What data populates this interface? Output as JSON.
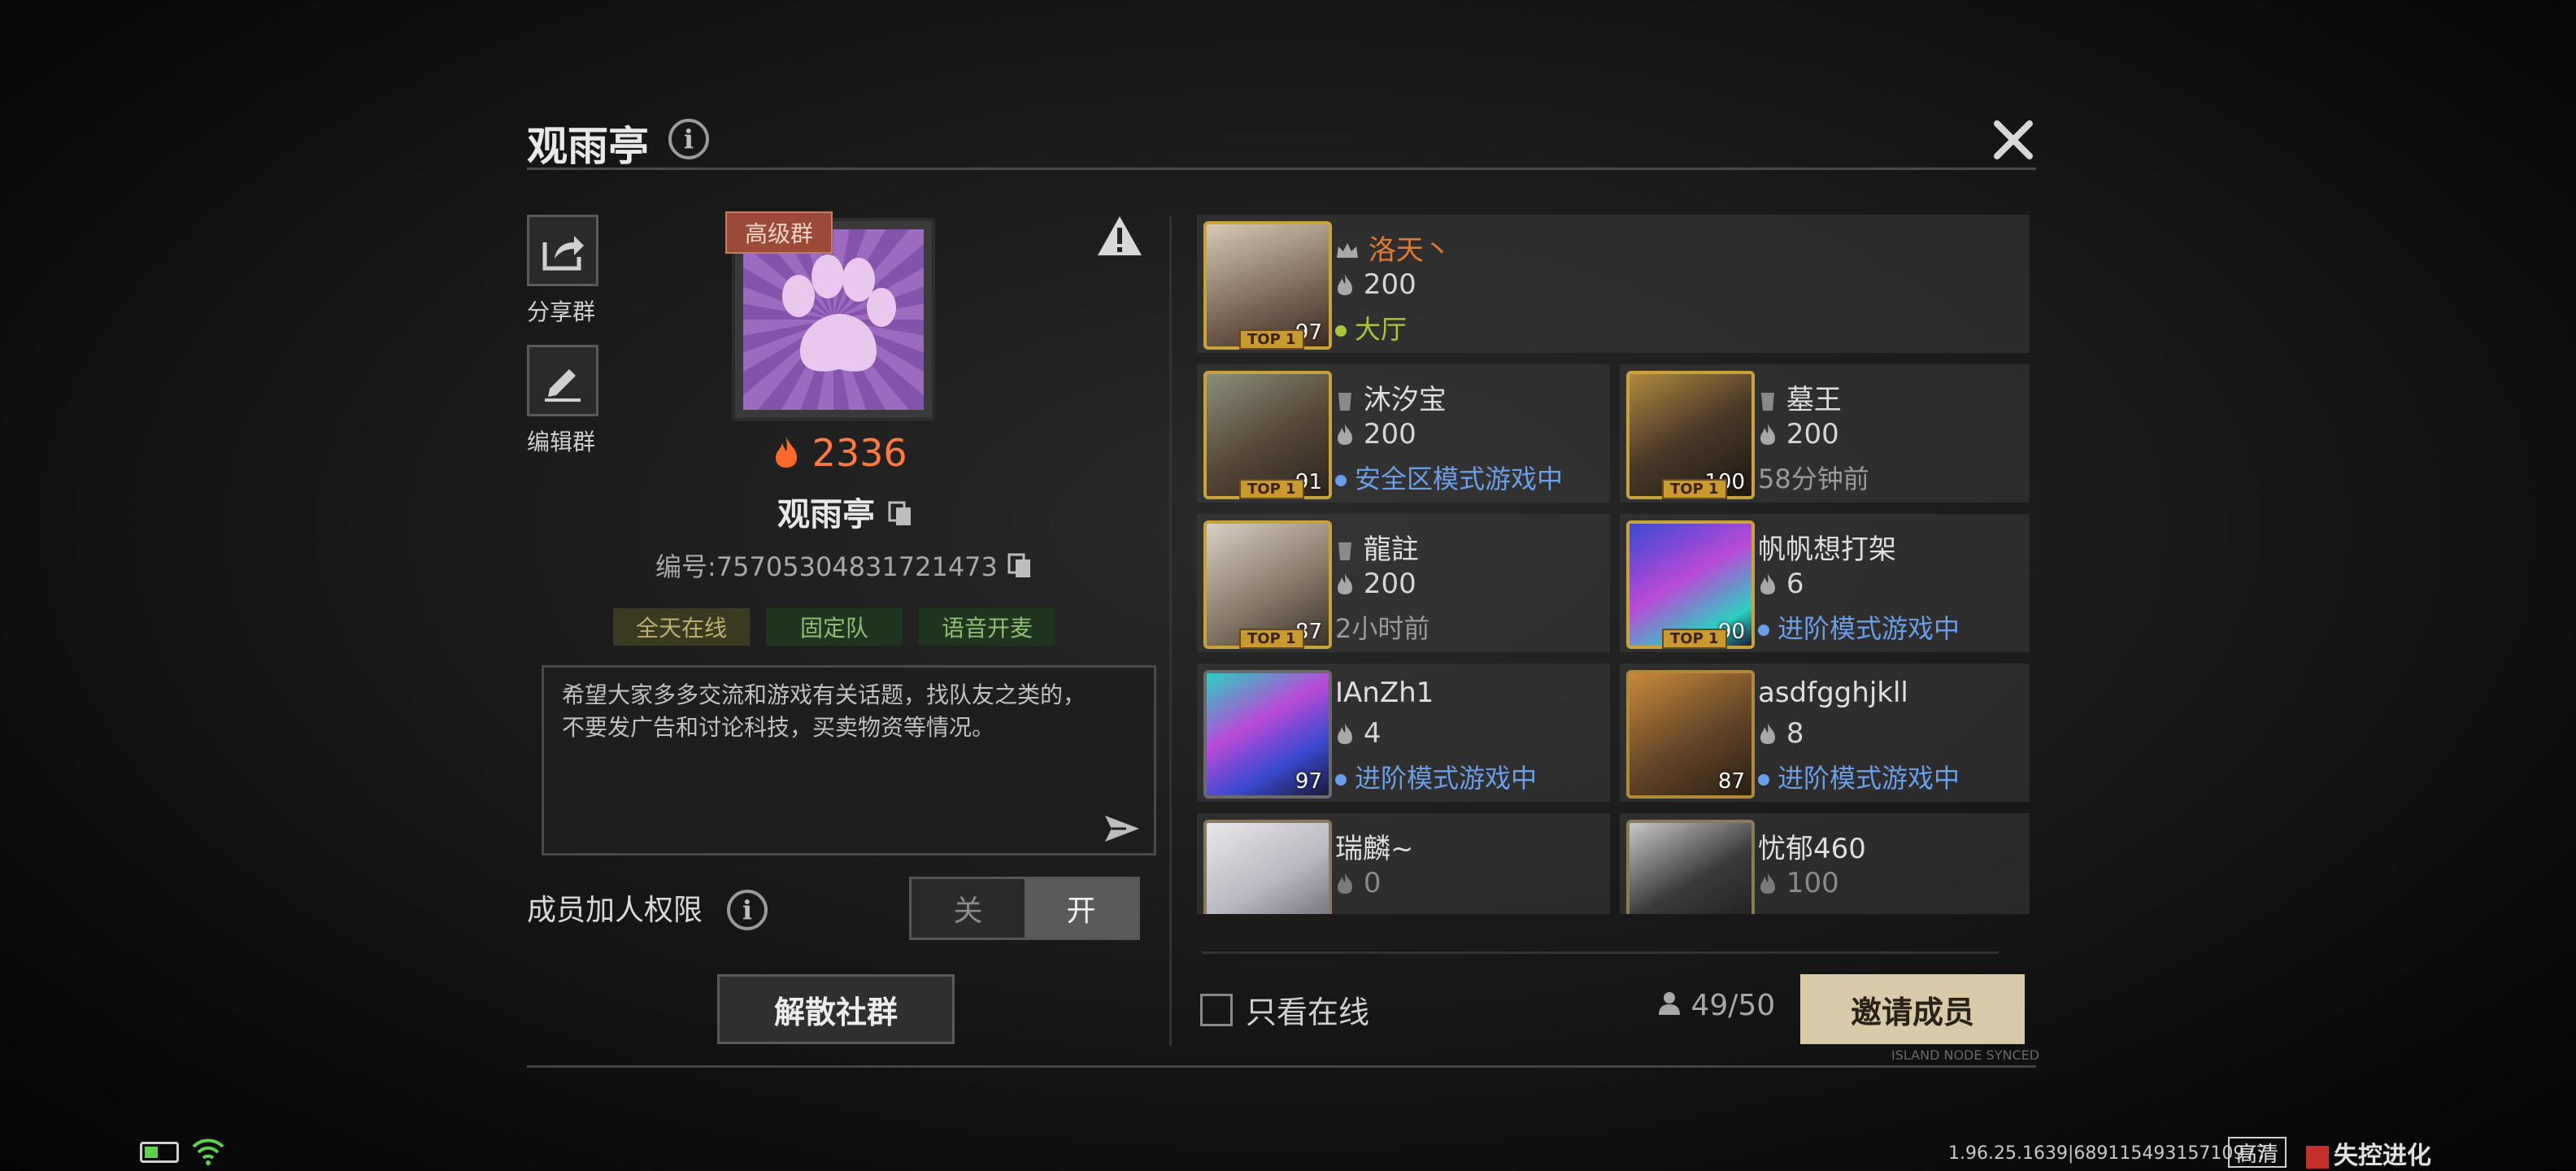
{
  "header": {
    "title": "观雨亭",
    "info_glyph": "i"
  },
  "sidebar": {
    "share_label": "分享群",
    "edit_label": "编辑群"
  },
  "group": {
    "tag": "高级群",
    "heat": "2336",
    "name": "观雨亭",
    "id_text": "编号:75705304831721473",
    "chips": [
      "全天在线",
      "固定队",
      "语音开麦"
    ],
    "description": "希望大家多多交流和游戏有关话题，找队友之类的，\n不要发广告和讨论科技，买卖物资等情况。"
  },
  "permission": {
    "label": "成员加人权限",
    "off": "关",
    "on": "开",
    "enabled": true
  },
  "disband_label": "解散社群",
  "members": [
    {
      "name": "洛天丶",
      "heat": "200",
      "status": "大厅",
      "status_color": "#a8c63a",
      "level": "97",
      "role": "owner",
      "top1": "TOP 1",
      "name_color": "#e07a30"
    },
    {
      "name": "沐汐宝",
      "heat": "200",
      "status": "安全区模式游戏中",
      "status_color": "#6a9ee8",
      "level": "91",
      "role": "admin",
      "top1": "TOP 1",
      "name_color": "#dedede"
    },
    {
      "name": "墓王",
      "heat": "200",
      "status": "58分钟前",
      "status_color": "#9a9a9a",
      "level": "100",
      "role": "admin",
      "top1": "TOP 1",
      "name_color": "#dedede"
    },
    {
      "name": "龍註",
      "heat": "200",
      "status": "2小时前",
      "status_color": "#9a9a9a",
      "level": "87",
      "role": "admin",
      "top1": "TOP 1",
      "name_color": "#dedede"
    },
    {
      "name": "帆帆想打架",
      "heat": "6",
      "status": "进阶模式游戏中",
      "status_color": "#6a9ee8",
      "level": "90",
      "role": "member",
      "top1": "TOP 1",
      "name_color": "#dedede"
    },
    {
      "name": "IAnZh1",
      "heat": "4",
      "status": "进阶模式游戏中",
      "status_color": "#6a9ee8",
      "level": "97",
      "role": "member",
      "top1": "",
      "name_color": "#dedede"
    },
    {
      "name": "asdfgghjkll",
      "heat": "8",
      "status": "进阶模式游戏中",
      "status_color": "#6a9ee8",
      "level": "87",
      "role": "member",
      "top1": "",
      "name_color": "#dedede"
    },
    {
      "name": "瑞麟~",
      "heat": "0",
      "status": "",
      "status_color": "#9a9a9a",
      "level": "",
      "role": "member",
      "top1": "",
      "name_color": "#dedede"
    },
    {
      "name": "忧郁460",
      "heat": "100",
      "status": "",
      "status_color": "#9a9a9a",
      "level": "",
      "role": "member",
      "top1": "",
      "name_color": "#dedede"
    }
  ],
  "footer": {
    "only_online_label": "只看在线",
    "count": "49/50",
    "invite_label": "邀请成员",
    "synced_text": "ISLAND NODE SYNCED"
  },
  "status_bar": {
    "version": "1.96.25.1639|68911549315710977",
    "quality": "高清",
    "game_logo_text": "失控进化"
  },
  "colors": {
    "heat": "#ff7a3c",
    "online_green": "#a8c63a",
    "ingame_blue": "#6a9ee8",
    "invite_bg": "#d8c9a8"
  }
}
